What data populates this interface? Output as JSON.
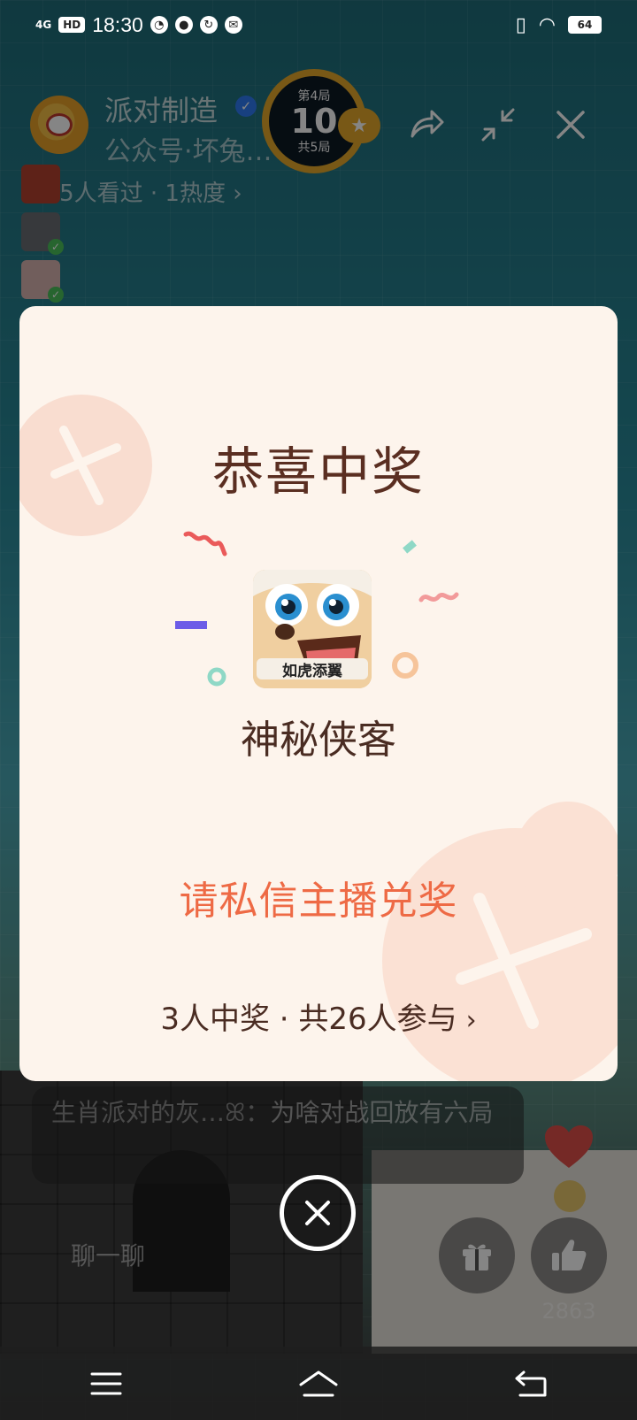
{
  "status_bar": {
    "network": "4G",
    "hd": "HD",
    "time": "18:30",
    "battery": "64"
  },
  "header": {
    "streamer_name": "派对制造",
    "subtitle": "公众号·坏兔…",
    "round": {
      "current": "第4局",
      "number": "10",
      "total": "共5局"
    },
    "viewers": "125人看过 · 1热度 ›"
  },
  "modal": {
    "title": "恭喜中奖",
    "prize_image_text": "如虎添翼",
    "prize_name": "神秘侠客",
    "claim_text": "请私信主播兑奖",
    "winners_text": "3人中奖 · 共26人参与",
    "chevron": "›"
  },
  "chat": {
    "user": "生肖派对的灰…",
    "separator": "ꕤ：",
    "message": "为啥对战回放有六局"
  },
  "bottom": {
    "input_placeholder": "聊一聊",
    "like_count": "2863"
  },
  "colors": {
    "modal_bg": "#fdf4ec",
    "title": "#5a2e21",
    "claim": "#ee6a45",
    "badge_ring": "#e6a92b"
  },
  "icons": [
    "share-icon",
    "shrink-icon",
    "close-icon",
    "gift-icon",
    "thumbs-up-icon",
    "heart-icon",
    "menu-icon",
    "home-icon",
    "back-icon"
  ]
}
